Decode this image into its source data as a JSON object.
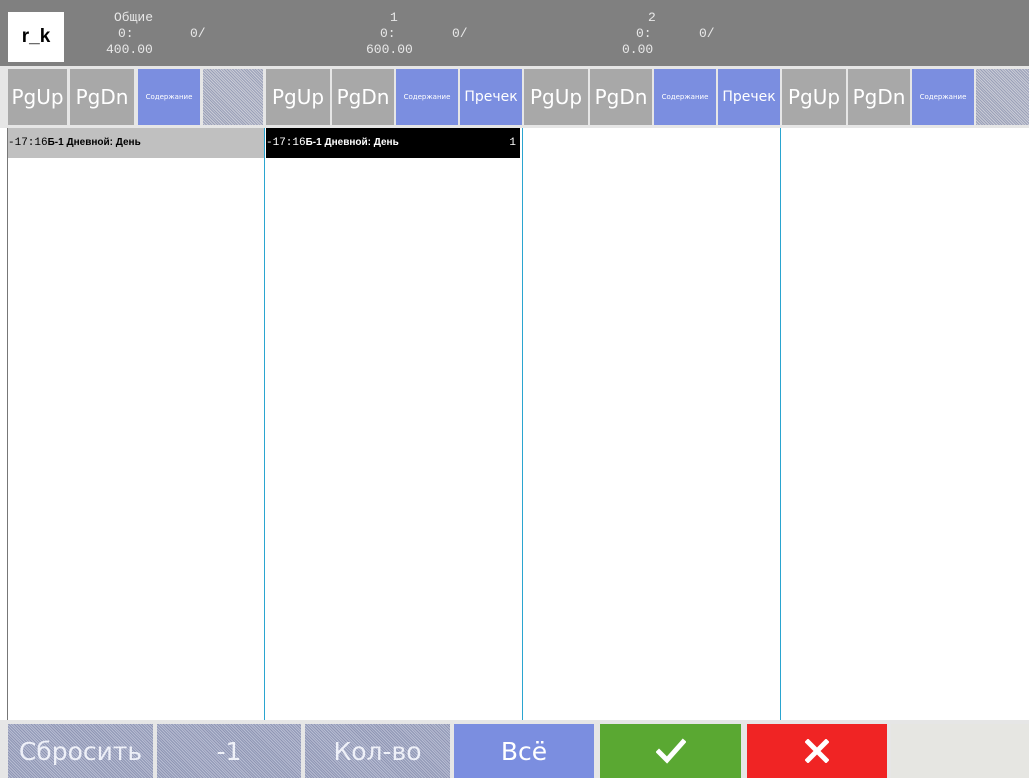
{
  "header": {
    "logo": "r_k",
    "stations": [
      {
        "title": "Общие",
        "count_label": "0:",
        "sent_label": "0/",
        "sum": "400.00"
      },
      {
        "title": "1",
        "count_label": "0:",
        "sent_label": "0/",
        "sum": "600.00"
      },
      {
        "title": "2",
        "count_label": "0:",
        "sent_label": "0/",
        "sum": "0.00"
      }
    ]
  },
  "columns": [
    {
      "pgup": "PgUp",
      "pgdn": "PgDn",
      "contents": "Содержание",
      "extra": ""
    },
    {
      "pgup": "PgUp",
      "pgdn": "PgDn",
      "contents": "Содержание",
      "extra": "Пречек"
    },
    {
      "pgup": "PgUp",
      "pgdn": "PgDn",
      "contents": "Содержание",
      "extra": "Пречек"
    },
    {
      "pgup": "PgUp",
      "pgdn": "PgDn",
      "contents": "Содержание",
      "extra": ""
    }
  ],
  "orders": [
    {
      "time": "-17:16",
      "name": "Б-1 Дневной: День",
      "count": ""
    },
    {
      "time": "-17:16",
      "name": "Б-1 Дневной: День",
      "count": "1"
    }
  ],
  "bottom": {
    "reset": "Сбросить",
    "minus_one": "-1",
    "quantity": "Кол-во",
    "all": "Всё",
    "confirm_icon": "checkmark-icon",
    "cancel_icon": "close-icon"
  },
  "colors": {
    "header_bg": "#808080",
    "gray_button": "#a8a8a8",
    "blue_button": "#7b8ee0",
    "confirm_green": "#5aa832",
    "cancel_red": "#f02424",
    "column_divider": "#2aa5d0",
    "selected_order_bg": "#000000",
    "highlight_order_bg": "#c0c0c0"
  }
}
